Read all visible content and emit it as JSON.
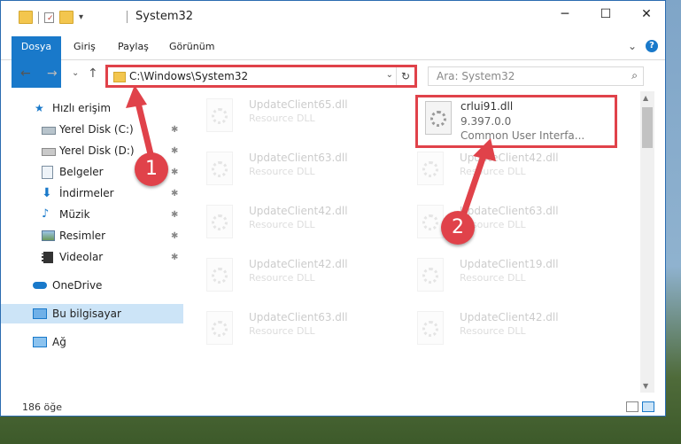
{
  "window": {
    "title": "System32"
  },
  "window_buttons": {
    "minimize": "─",
    "maximize": "☐",
    "close": "✕"
  },
  "ribbon": {
    "tabs": [
      "Dosya",
      "Giriş",
      "Paylaş",
      "Görünüm"
    ],
    "collapse": "⌄",
    "help": "?"
  },
  "nav": {
    "back": "←",
    "forward": "→",
    "recent": "⌄",
    "up": "↑"
  },
  "address": {
    "path": "C:\\Windows\\System32",
    "dropdown": "⌄",
    "refresh": "↻"
  },
  "search": {
    "placeholder": "Ara: System32",
    "icon": "⌕"
  },
  "sidebar": {
    "items": [
      {
        "label": "Hızlı erişim",
        "icon": "star-icon",
        "pinned": false
      },
      {
        "label": "Yerel Disk (C:)",
        "icon": "drive-icon",
        "pinned": true
      },
      {
        "label": "Yerel Disk (D:)",
        "icon": "drive-icon",
        "pinned": true
      },
      {
        "label": "Belgeler",
        "icon": "documents-icon",
        "pinned": true
      },
      {
        "label": "İndirmeler",
        "icon": "download-icon",
        "pinned": true
      },
      {
        "label": "Müzik",
        "icon": "music-icon",
        "pinned": true
      },
      {
        "label": "Resimler",
        "icon": "pictures-icon",
        "pinned": true
      },
      {
        "label": "Videolar",
        "icon": "videos-icon",
        "pinned": true
      },
      {
        "label": "OneDrive",
        "icon": "cloud-icon",
        "pinned": false
      },
      {
        "label": "Bu bilgisayar",
        "icon": "computer-icon",
        "pinned": false
      },
      {
        "label": "Ağ",
        "icon": "network-icon",
        "pinned": false
      }
    ],
    "pin_glyph": "📌"
  },
  "files": [
    {
      "name": "UpdateClient65.dll",
      "desc": "Resource DLL",
      "faded": true
    },
    {
      "name": "crlui91.dll",
      "desc": "9.397.0.0",
      "desc2": "Common User Interfa...",
      "faded": false,
      "selected": true
    },
    {
      "name": "UpdateClient63.dll",
      "desc": "Resource DLL",
      "faded": true
    },
    {
      "name": "UpdateClient42.dll",
      "desc": "Resource DLL",
      "faded": true
    },
    {
      "name": "UpdateClient42.dll",
      "desc": "Resource DLL",
      "faded": true
    },
    {
      "name": "UpdateClient63.dll",
      "desc": "Resource DLL",
      "faded": true
    },
    {
      "name": "UpdateClient42.dll",
      "desc": "Resource DLL",
      "faded": true
    },
    {
      "name": "UpdateClient19.dll",
      "desc": "Resource DLL",
      "faded": true
    },
    {
      "name": "UpdateClient63.dll",
      "desc": "Resource DLL",
      "faded": true
    },
    {
      "name": "UpdateClient42.dll",
      "desc": "Resource DLL",
      "faded": true
    }
  ],
  "status": {
    "count": "186 öğe"
  },
  "annotations": {
    "badge1": "1",
    "badge2": "2"
  },
  "colors": {
    "accent": "#1979ca",
    "annotation_red": "#e0424a",
    "selected_nav": "#cce4f7"
  }
}
